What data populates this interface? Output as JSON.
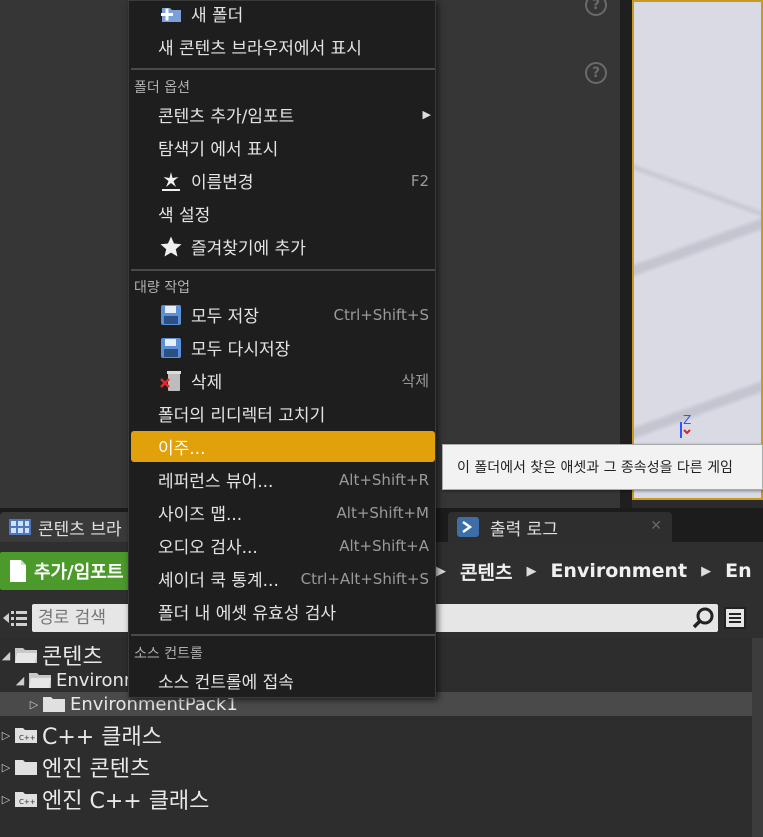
{
  "context_menu": {
    "items_top": [
      {
        "label": "새 폴더",
        "icon": "new-folder-icon"
      },
      {
        "label": "새 콘텐츠 브라우저에서 표시"
      }
    ],
    "section_folder_options": {
      "header": "폴더 옵션",
      "items": [
        {
          "label": "콘텐츠 추가/임포트",
          "submenu": true
        },
        {
          "label": "탐색기 에서 표시"
        },
        {
          "label": "이름변경",
          "shortcut": "F2",
          "icon": "rename-icon"
        },
        {
          "label": "색 설정"
        },
        {
          "label": "즐겨찾기에 추가",
          "icon": "star-icon"
        }
      ]
    },
    "section_bulk_actions": {
      "header": "대량 작업",
      "items": [
        {
          "label": "모두 저장",
          "shortcut": "Ctrl+Shift+S",
          "icon": "save-icon"
        },
        {
          "label": "모두 다시저장",
          "icon": "save-icon"
        },
        {
          "label": "삭제",
          "shortcut": "삭제",
          "icon": "delete-icon"
        },
        {
          "label": "폴더의 리디렉터 고치기"
        },
        {
          "label": "이주...",
          "highlighted": true
        },
        {
          "label": "레퍼런스 뷰어...",
          "shortcut": "Alt+Shift+R"
        },
        {
          "label": "사이즈 맵...",
          "shortcut": "Alt+Shift+M"
        },
        {
          "label": "오디오 검사...",
          "shortcut": "Alt+Shift+A"
        },
        {
          "label": "셰이더 쿡 통계...",
          "shortcut": "Ctrl+Alt+Shift+S"
        },
        {
          "label": "폴더 내 에셋 유효성 검사"
        }
      ]
    },
    "section_source_control": {
      "header": "소스 컨트롤",
      "items": [
        {
          "label": "소스 컨트롤에 접속"
        }
      ]
    }
  },
  "tooltip": {
    "text": "이 폴더에서 찾은 애셋과 그 종속성을 다른 게임"
  },
  "dock": {
    "tab_content_browser": "콘텐츠 브라",
    "tab_output_log": "출력 로그",
    "tab_close": "✕"
  },
  "toolbar": {
    "add_import_label": "추가/임포트",
    "breadcrumb": [
      "콘텐츠",
      "Environment",
      "En"
    ]
  },
  "path_search": {
    "placeholder": "경로 검색"
  },
  "folder_tree": {
    "rows": [
      {
        "label": "콘텐츠"
      },
      {
        "label": "Environm"
      },
      {
        "label": "EnvironmentPack1"
      },
      {
        "label": "C++ 클래스"
      },
      {
        "label": "엔진 콘텐츠"
      },
      {
        "label": "엔진 C++ 클래스"
      }
    ]
  },
  "viewport": {
    "axis_label": "Z"
  },
  "colors": {
    "highlight": "#e0a10a",
    "add_button": "#4b9a2b",
    "viewport_border": "#c99a22"
  }
}
